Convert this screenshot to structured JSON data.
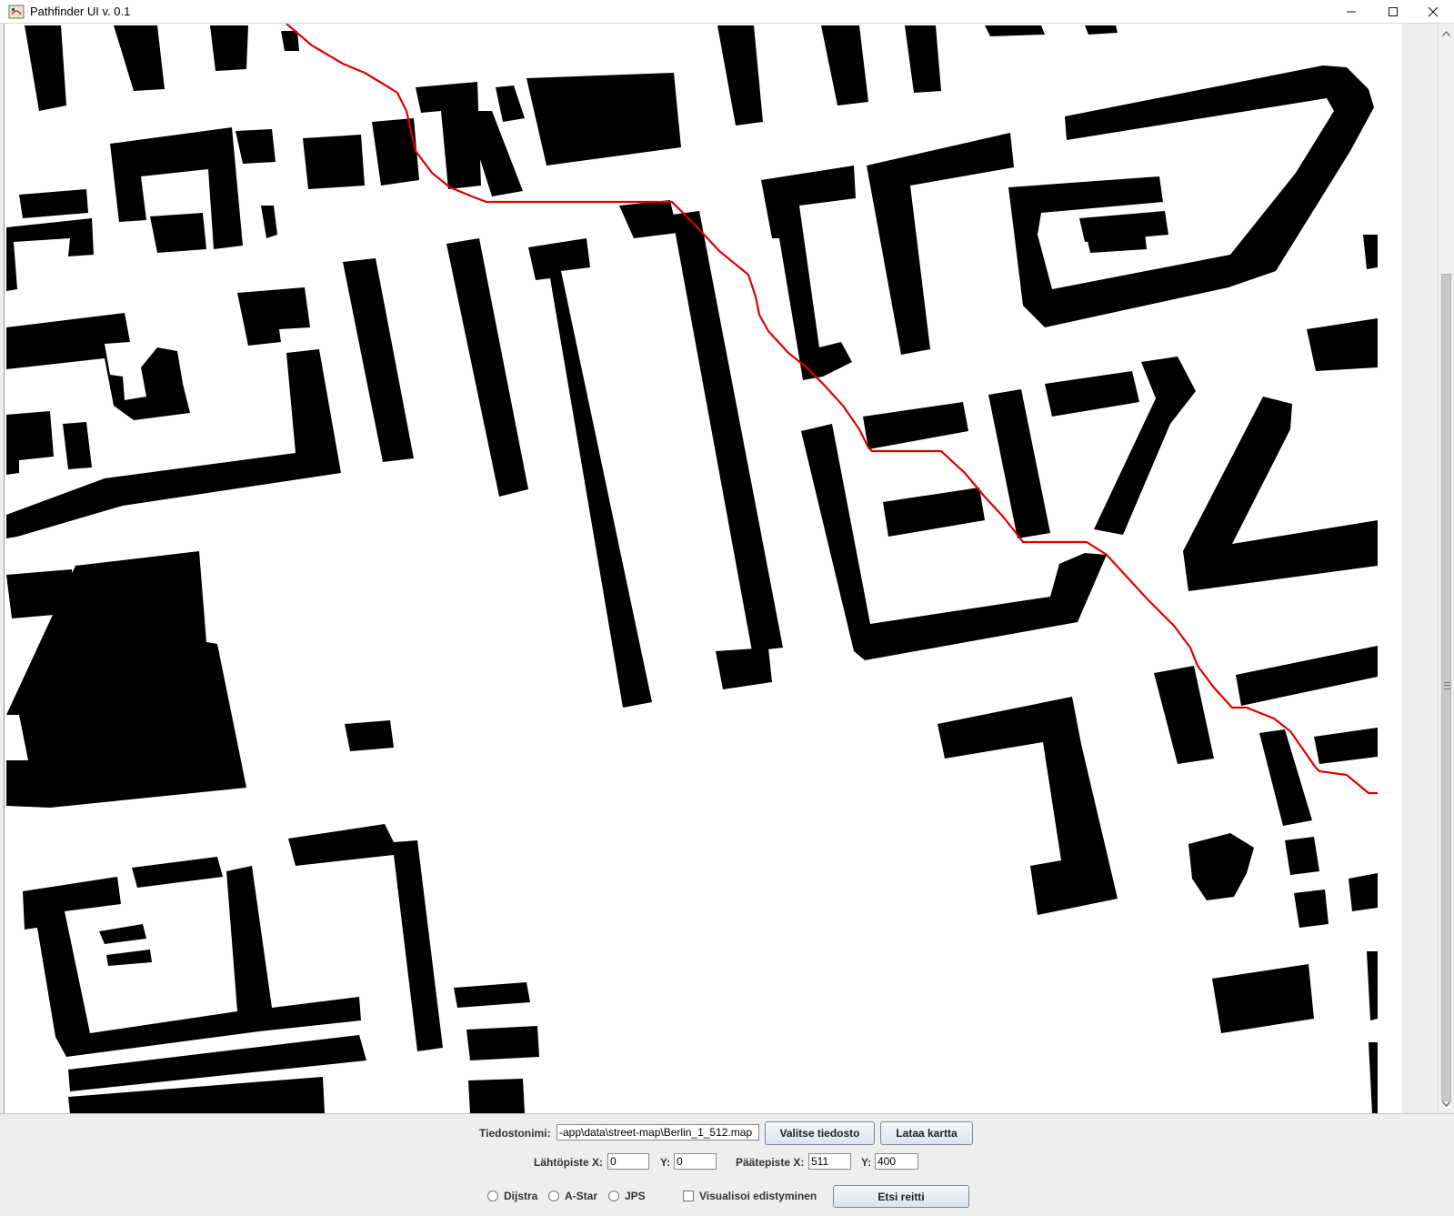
{
  "window": {
    "title": "Pathfinder UI v. 0.1",
    "controls": [
      "minimize-icon",
      "maximize-icon",
      "close-icon"
    ]
  },
  "map": {
    "colors": {
      "background": "#ffffff",
      "obstacle": "#000000",
      "path": "#dd0000"
    },
    "has_path": true
  },
  "controls": {
    "filename_label": "Tiedostonimi:",
    "filename_value": "-app\\data\\street-map\\Berlin_1_512.map",
    "choose_file_button": "Valitse tiedosto",
    "load_map_button": "Lataa kartta",
    "start_x_label": "Lähtöpiste X:",
    "start_x_value": "0",
    "start_y_label": "Y:",
    "start_y_value": "0",
    "end_x_label": "Päätepiste X:",
    "end_x_value": "511",
    "end_y_label": "Y:",
    "end_y_value": "400",
    "algorithms": [
      {
        "label": "Dijstra",
        "selected": false
      },
      {
        "label": "A-Star",
        "selected": false
      },
      {
        "label": "JPS",
        "selected": false
      }
    ],
    "visualize_label": "Visualisoi edistyminen",
    "visualize_checked": false,
    "search_button": "Etsi reitti"
  }
}
